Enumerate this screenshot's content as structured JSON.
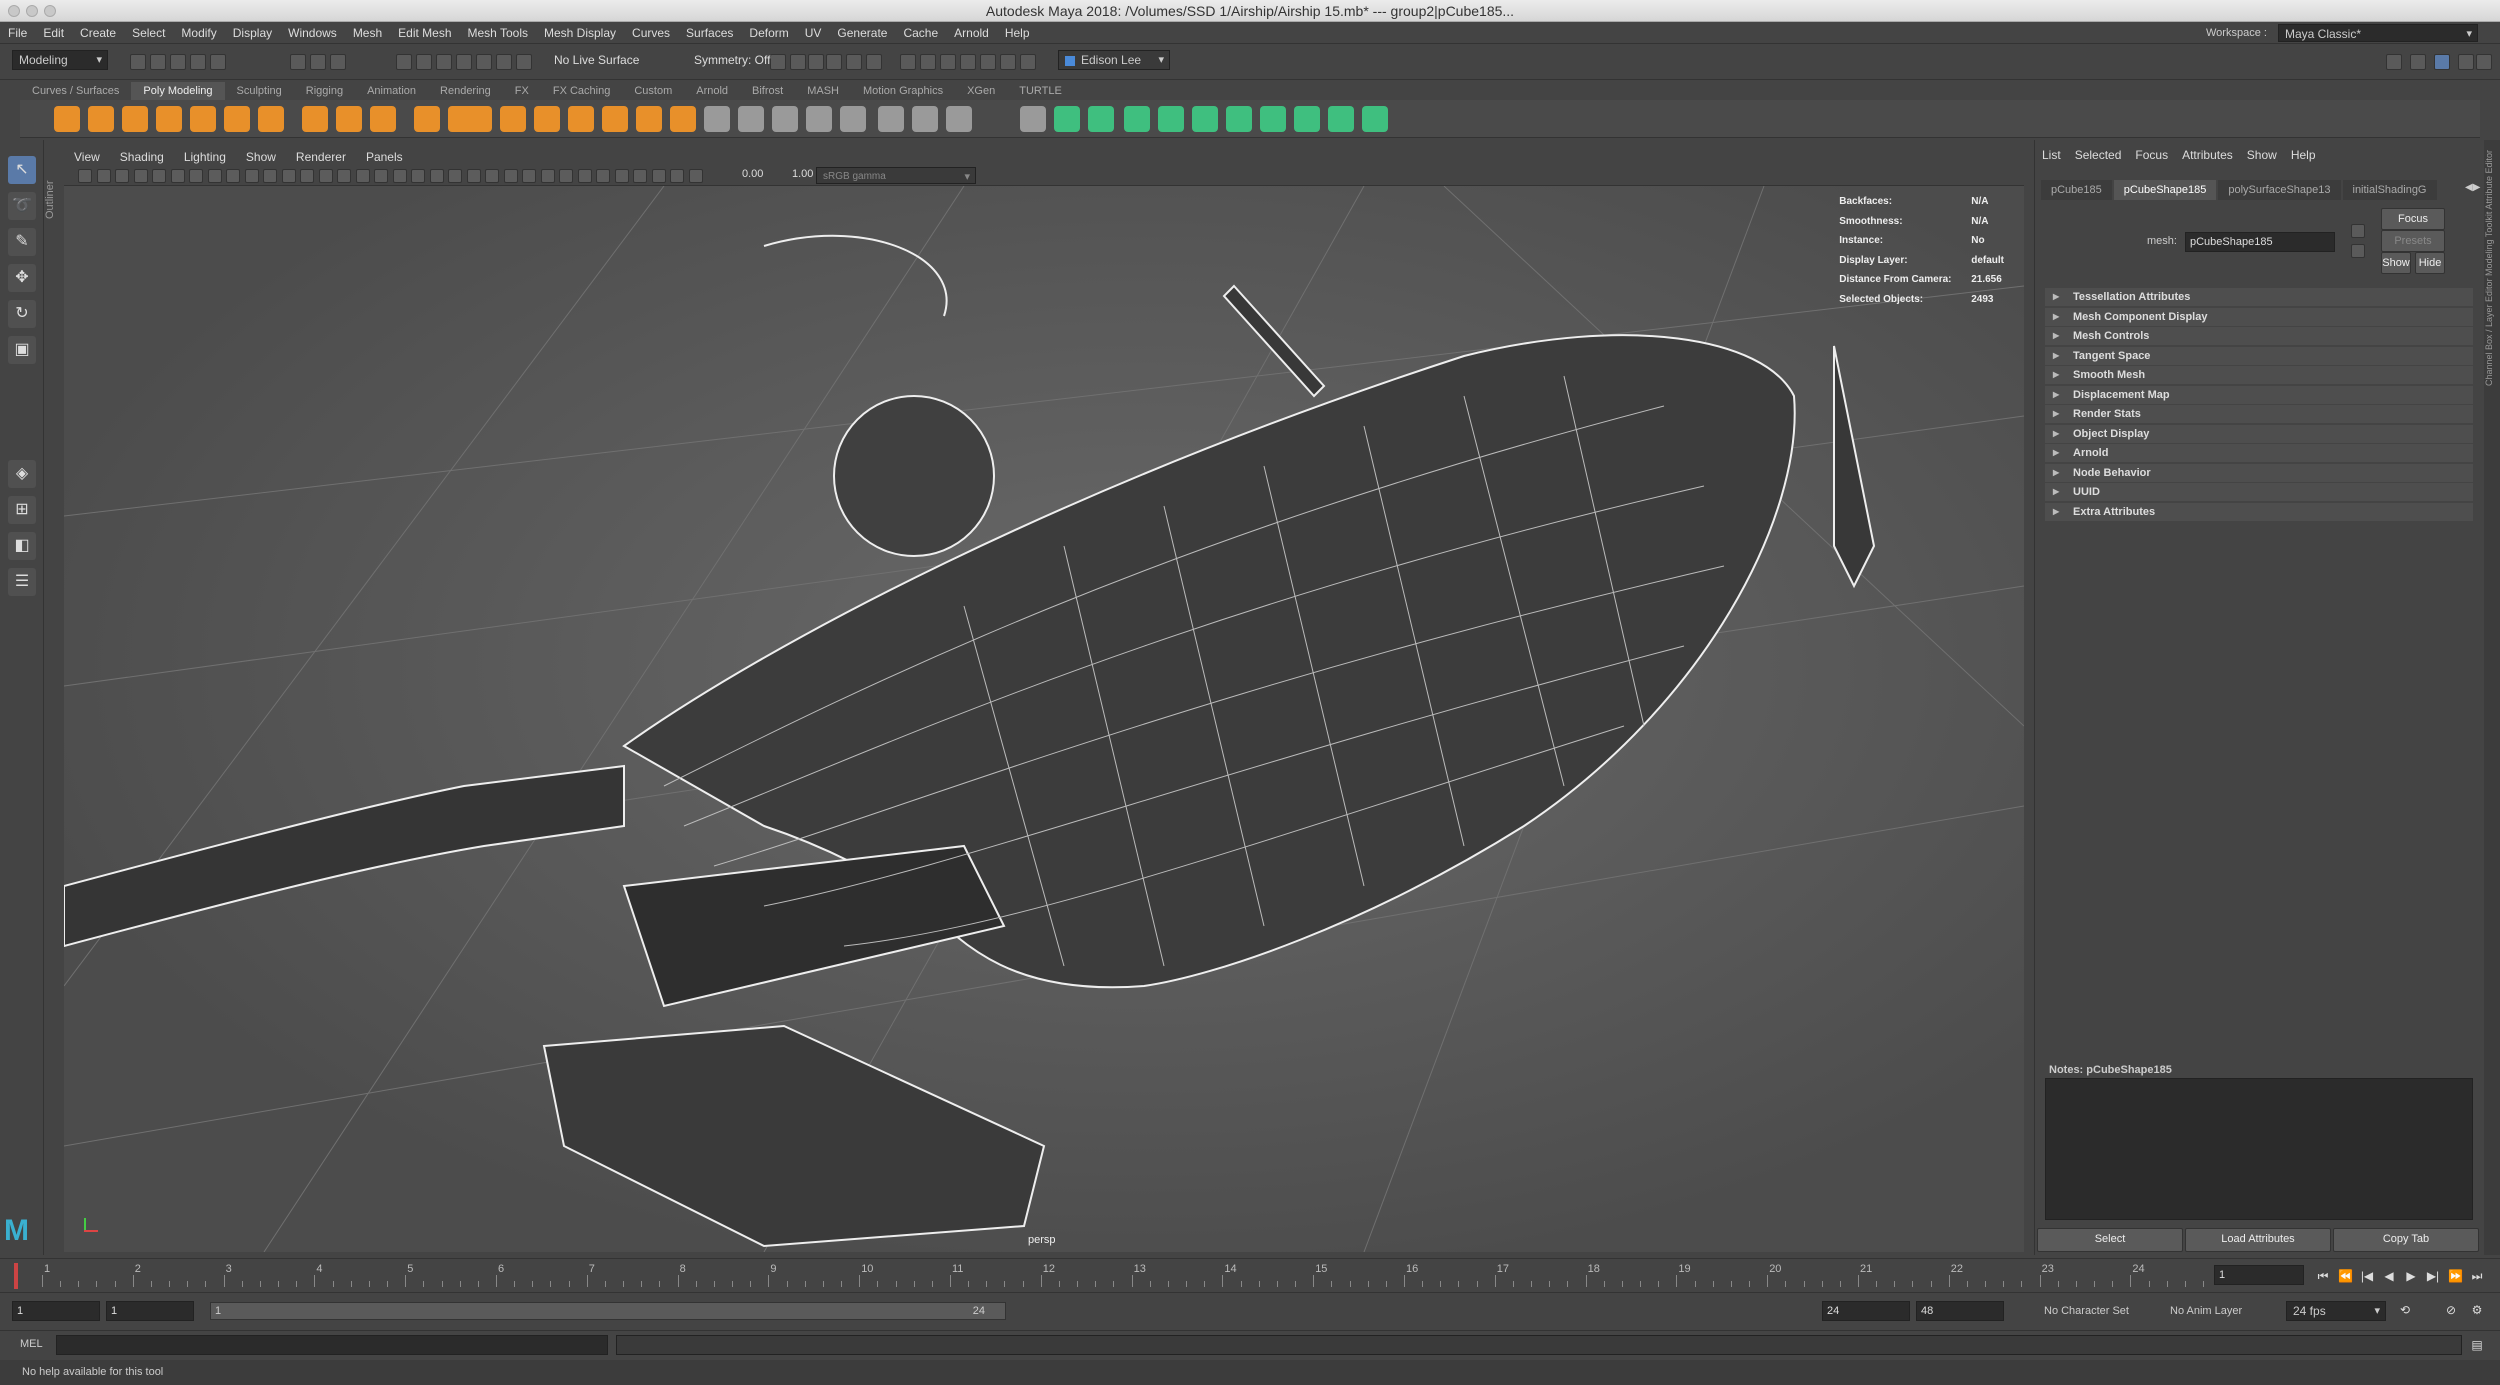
{
  "window": {
    "title": "Autodesk Maya 2018: /Volumes/SSD 1/Airship/Airship 15.mb*  ---  group2|pCube185..."
  },
  "menubar": {
    "items": [
      "File",
      "Edit",
      "Create",
      "Select",
      "Modify",
      "Display",
      "Windows",
      "Mesh",
      "Edit Mesh",
      "Mesh Tools",
      "Mesh Display",
      "Curves",
      "Surfaces",
      "Deform",
      "UV",
      "Generate",
      "Cache",
      "Arnold",
      "Help"
    ],
    "workspace_label": "Workspace :",
    "workspace_value": "Maya Classic*"
  },
  "statusline": {
    "menuset": "Modeling",
    "live_surface": "No Live Surface",
    "symmetry": "Symmetry: Off",
    "user": "Edison Lee"
  },
  "shelf": {
    "tabs": [
      "Curves / Surfaces",
      "Poly Modeling",
      "Sculpting",
      "Rigging",
      "Animation",
      "Rendering",
      "FX",
      "FX Caching",
      "Custom",
      "Arnold",
      "Bifrost",
      "MASH",
      "Motion Graphics",
      "XGen",
      "TURTLE"
    ],
    "active_tab": "Poly Modeling",
    "orange": "#e8902a",
    "green": "#3fbf7f"
  },
  "outliner_label": "Outliner",
  "viewport": {
    "menus": [
      "View",
      "Shading",
      "Lighting",
      "Show",
      "Renderer",
      "Panels"
    ],
    "exposure": "0.00",
    "gamma": "1.00",
    "color_space": "sRGB gamma",
    "camera": "persp",
    "hud": [
      {
        "label": "Backfaces:",
        "value": "N/A"
      },
      {
        "label": "Smoothness:",
        "value": "N/A"
      },
      {
        "label": "Instance:",
        "value": "No"
      },
      {
        "label": "Display Layer:",
        "value": "default"
      },
      {
        "label": "Distance From Camera:",
        "value": "21.656"
      },
      {
        "label": "Selected Objects:",
        "value": "2493"
      }
    ]
  },
  "attribute_editor": {
    "menus": [
      "List",
      "Selected",
      "Focus",
      "Attributes",
      "Show",
      "Help"
    ],
    "tabs": [
      "pCube185",
      "pCubeShape185",
      "polySurfaceShape13",
      "initialShadingG"
    ],
    "active_tab": "pCubeShape185",
    "mesh_label": "mesh:",
    "mesh_value": "pCubeShape185",
    "focus_btn": "Focus",
    "presets_btn": "Presets",
    "show_btn": "Show",
    "hide_btn": "Hide",
    "sections": [
      "Tessellation Attributes",
      "Mesh Component Display",
      "Mesh Controls",
      "Tangent Space",
      "Smooth Mesh",
      "Displacement Map",
      "Render Stats",
      "Object Display",
      "Arnold",
      "Node Behavior",
      "UUID",
      "Extra Attributes"
    ],
    "notes_label": "Notes:  pCubeShape185",
    "select_btn": "Select",
    "load_btn": "Load Attributes",
    "copy_btn": "Copy Tab",
    "side_tabs": "Channel Box / Layer Editor    Modeling Toolkit    Attribute Editor"
  },
  "timeline": {
    "ticks": [
      "1",
      "2",
      "3",
      "4",
      "5",
      "6",
      "7",
      "8",
      "9",
      "10",
      "11",
      "12",
      "13",
      "14",
      "15",
      "16",
      "17",
      "18",
      "19",
      "20",
      "21",
      "22",
      "23",
      "24"
    ],
    "current_frame": "1",
    "range_start": "1",
    "range_start2": "1",
    "slider_start": "1",
    "slider_end": "24",
    "range_end": "24",
    "range_end2": "48",
    "character_set": "No Character Set",
    "anim_layer": "No Anim Layer",
    "fps": "24 fps"
  },
  "cmdline": {
    "lang": "MEL"
  },
  "helpline": {
    "text": "No help available for this tool"
  }
}
